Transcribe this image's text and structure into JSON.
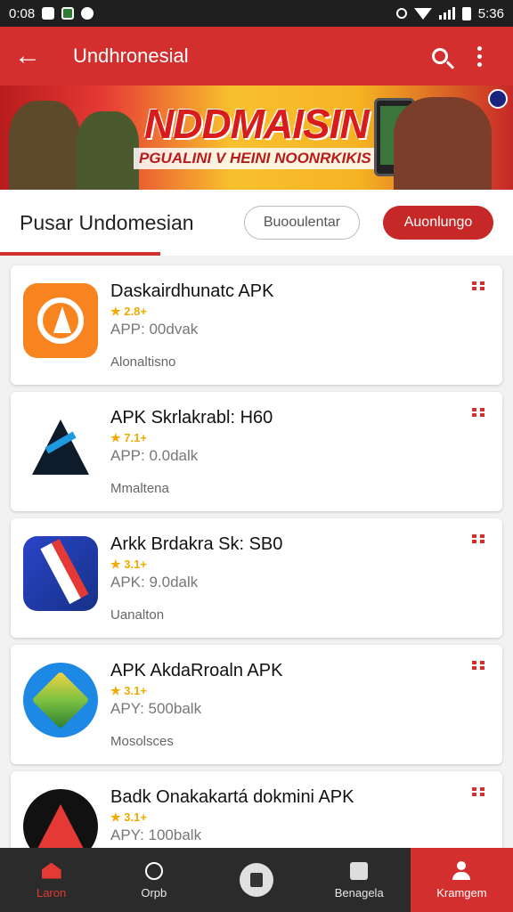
{
  "status_bar": {
    "time_left": "0:08",
    "time_right": "5:36"
  },
  "app_bar": {
    "title": "Undhronesial"
  },
  "banner": {
    "headline": "NDDMAISIN",
    "subline": "PGUALINI V HEINI NOONRKIKIS"
  },
  "section": {
    "title": "Pusar Undomesian",
    "chip_outline": "Buooulentar",
    "chip_filled": "Auonlungo"
  },
  "apps": [
    {
      "name": "Daskairdhunatc APK",
      "rating": "★ 2.8+",
      "size": "APP: 00dvak",
      "category": "Alonaltisno"
    },
    {
      "name": "APK Skrlakrabl: H60",
      "rating": "★ 7.1+",
      "size": "APP: 0.0dalk",
      "category": "Mmaltena"
    },
    {
      "name": "Arkk Brdakra Sk: SB0",
      "rating": "★ 3.1+",
      "size": "APK: 9.0dalk",
      "category": "Uanalton"
    },
    {
      "name": "APK AkdaRroaln APK",
      "rating": "★ 3.1+",
      "size": "APY: 500balk",
      "category": "Mosolsces"
    },
    {
      "name": "Badk Onakakartá dokmini APK",
      "rating": "★ 3.1+",
      "size": "APY: 100balk",
      "category": ""
    }
  ],
  "bottom_nav": [
    {
      "label": "Laron"
    },
    {
      "label": "Orpb"
    },
    {
      "label": ""
    },
    {
      "label": "Benagela"
    },
    {
      "label": "Kramgem"
    }
  ],
  "colors": {
    "primary": "#d32f2f",
    "star": "#f2a900",
    "nav_bg": "#2b2b2b"
  }
}
